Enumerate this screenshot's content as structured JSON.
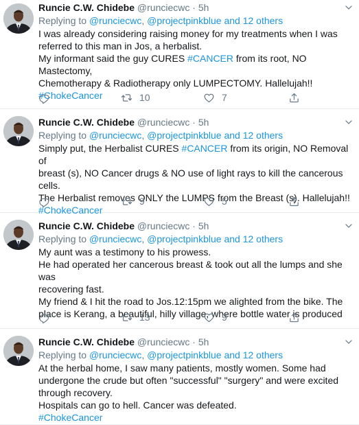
{
  "tweets": [
    {
      "name": "Runcie C.W. Chidebe",
      "handle": "@runciecwc",
      "dot": "·",
      "time": "5h",
      "reply": {
        "prefix": "Replying to",
        "mention1": "@runciecwc",
        "sep": ",",
        "mention2": "@projectpinkblue",
        "and_others": "and 12 others"
      },
      "lines": [
        [
          "I was already considering raising money for my treatments when I was"
        ],
        [
          "referred to this man in Jos, a herbalist."
        ],
        [
          "My informant said the guy CURES ",
          {
            "tag": "#CANCER"
          },
          " from its root, NO Mastectomy,"
        ],
        [
          "Chemotherapy & Radiotherapy only LUMPECTOMY. Hallelujah!!"
        ],
        [
          {
            "tag": "#ChokeCancer"
          }
        ]
      ],
      "retweets": "10",
      "likes": "7"
    },
    {
      "name": "Runcie C.W. Chidebe",
      "handle": "@runciecwc",
      "dot": "·",
      "time": "5h",
      "reply": {
        "prefix": "Replying to",
        "mention1": "@runciecwc",
        "sep": ",",
        "mention2": "@projectpinkblue",
        "and_others": "and 12 others"
      },
      "lines": [
        [
          "Simply put, the Herbalist CURES ",
          {
            "tag": "#CANCER"
          },
          " from its origin, NO Removal of"
        ],
        [
          "breast (s), NO Cancer drugs & NO use of light rays to kill the cancerous cells."
        ],
        [
          "The Herbalist removes ONLY the LUMPS from the Breast (s). Hallelujah!!"
        ],
        [
          {
            "tag": "#ChokeCancer"
          }
        ]
      ],
      "retweets": "9",
      "likes": "5"
    },
    {
      "name": "Runcie C.W. Chidebe",
      "handle": "@runciecwc",
      "dot": "·",
      "time": "5h",
      "reply": {
        "prefix": "Replying to",
        "mention1": "@runciecwc",
        "sep": ",",
        "mention2": "@projectpinkblue",
        "and_others": "and 12 others"
      },
      "lines": [
        [
          "My aunt was a testimony to his prowess."
        ],
        [
          "He had operated her cancerous breast & took out all the lumps and she was"
        ],
        [
          "recovering fast."
        ],
        [
          "My friend & I hit the road to Jos.12:15pm we alighted from the bike. The"
        ],
        [
          "place is Kerang, a beautiful, hilly village, where bottle water is produced"
        ]
      ],
      "retweets": "13",
      "likes": "9"
    },
    {
      "name": "Runcie C.W. Chidebe",
      "handle": "@runciecwc",
      "dot": "·",
      "time": "5h",
      "reply": {
        "prefix": "Replying to",
        "mention1": "@runciecwc",
        "sep": ",",
        "mention2": "@projectpinkblue",
        "and_others": "and 12 others"
      },
      "lines": [
        [
          "At the herbal home, I saw many patients, mostly women. Some had"
        ],
        [
          "undergone the crude but often \"successful\" \"surgery\" and were excited"
        ],
        [
          "through recovery."
        ],
        [
          "Hospitals can go to hell. Cancer was defeated."
        ],
        [
          {
            "tag": "#ChokeCancer"
          }
        ]
      ],
      "retweets": "",
      "likes": ""
    }
  ]
}
